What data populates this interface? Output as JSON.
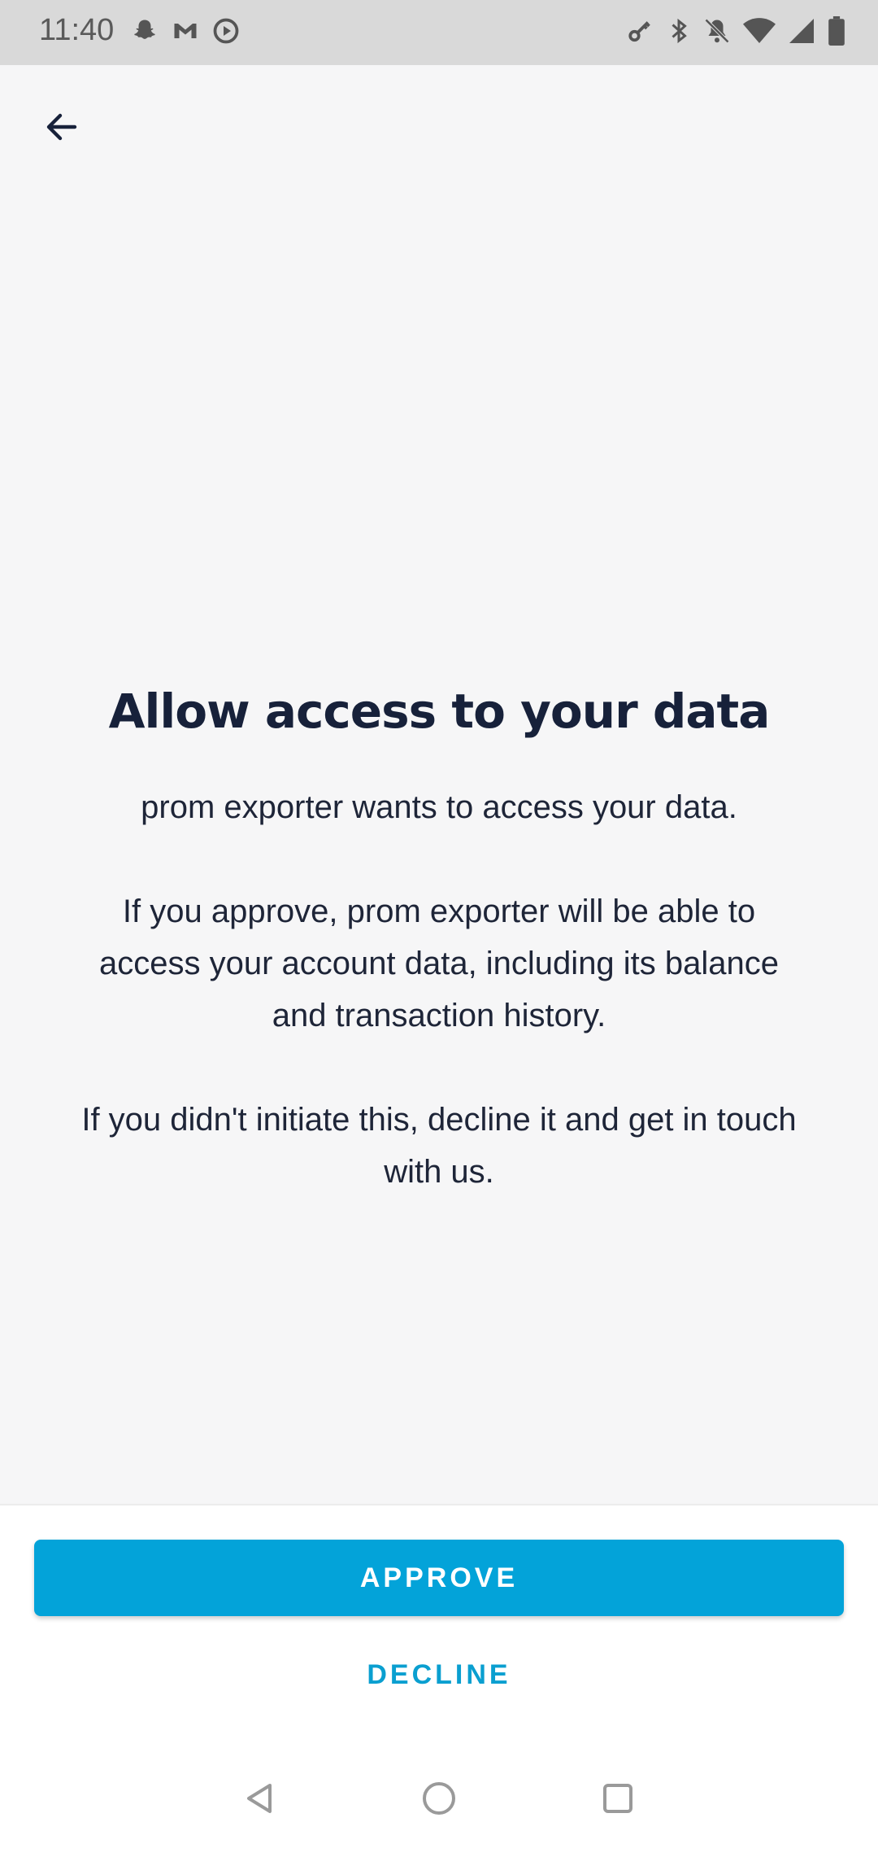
{
  "status_bar": {
    "time": "11:40",
    "left_icons": [
      "snapchat-icon",
      "gmail-icon",
      "media-play-icon"
    ],
    "right_icons": [
      "vpn-key-icon",
      "bluetooth-icon",
      "notifications-off-icon",
      "wifi-icon",
      "cell-signal-icon",
      "battery-icon"
    ]
  },
  "header": {
    "back_icon": "arrow-left-icon"
  },
  "main": {
    "title": "Allow access to your data",
    "paragraph_1": "prom exporter wants to access your data.",
    "paragraph_2": "If you approve, prom exporter will be able to access your account data, including its balance and transaction history.",
    "paragraph_3": "If you didn't initiate this, decline it and get in touch with us."
  },
  "footer": {
    "approve_label": "APPROVE",
    "decline_label": "DECLINE",
    "accent_color": "#03a3d9"
  },
  "nav_bar": {
    "icons": [
      "nav-back-icon",
      "nav-home-icon",
      "nav-recents-icon"
    ]
  }
}
